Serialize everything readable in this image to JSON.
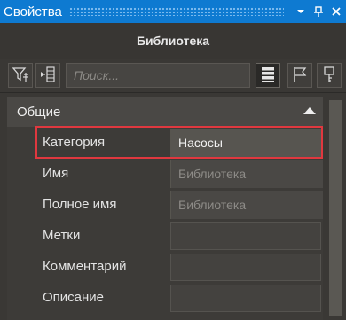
{
  "window": {
    "title": "Свойства"
  },
  "header": {
    "title": "Библиотека"
  },
  "toolbar": {
    "search_placeholder": "Поиск...",
    "icons": [
      "filter-icon",
      "collapse-all-icon",
      "list-view-icon",
      "flag-icon",
      "key-icon"
    ]
  },
  "section": {
    "title": "Общие"
  },
  "properties": [
    {
      "label": "Категория",
      "value": "Насосы"
    },
    {
      "label": "Имя",
      "value": "Библиотека"
    },
    {
      "label": "Полное имя",
      "value": "Библиотека"
    },
    {
      "label": "Метки",
      "value": ""
    },
    {
      "label": "Комментарий",
      "value": ""
    },
    {
      "label": "Описание",
      "value": ""
    }
  ],
  "colors": {
    "titlebar": "#0e7ad1",
    "highlight": "#e0383f"
  }
}
